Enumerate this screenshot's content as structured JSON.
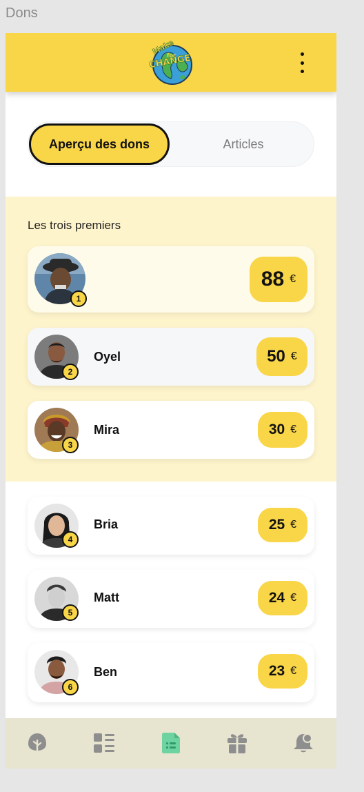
{
  "frame": {
    "label": "Dons"
  },
  "header": {
    "logo": {
      "line1": "Make",
      "line2": "for",
      "line3": "CHANGE"
    },
    "menu_icon": "more-vertical-icon"
  },
  "tabs": {
    "active_label": "Aperçu des dons",
    "inactive_label": "Articles"
  },
  "top_section": {
    "title": "Les trois premiers"
  },
  "donors": [
    {
      "rank": "1",
      "name": "",
      "amount": "88",
      "currency": "€"
    },
    {
      "rank": "2",
      "name": "Oyel",
      "amount": "50",
      "currency": "€"
    },
    {
      "rank": "3",
      "name": "Mira",
      "amount": "30",
      "currency": "€"
    },
    {
      "rank": "4",
      "name": "Bria",
      "amount": "25",
      "currency": "€"
    },
    {
      "rank": "5",
      "name": "Matt",
      "amount": "24",
      "currency": "€"
    },
    {
      "rank": "6",
      "name": "Ben",
      "amount": "23",
      "currency": "€"
    }
  ],
  "nav": {
    "items": [
      {
        "icon": "tree-icon",
        "active": false
      },
      {
        "icon": "list-icon",
        "active": false
      },
      {
        "icon": "document-icon",
        "active": true
      },
      {
        "icon": "gift-icon",
        "active": false
      },
      {
        "icon": "bell-icon",
        "active": false
      }
    ]
  },
  "colors": {
    "accent_yellow": "#f9d548",
    "top_section_bg": "#fef4cc",
    "nav_bg": "#e7e4d0",
    "nav_active": "#6dd3a0",
    "nav_inactive": "#8e8e8e"
  }
}
